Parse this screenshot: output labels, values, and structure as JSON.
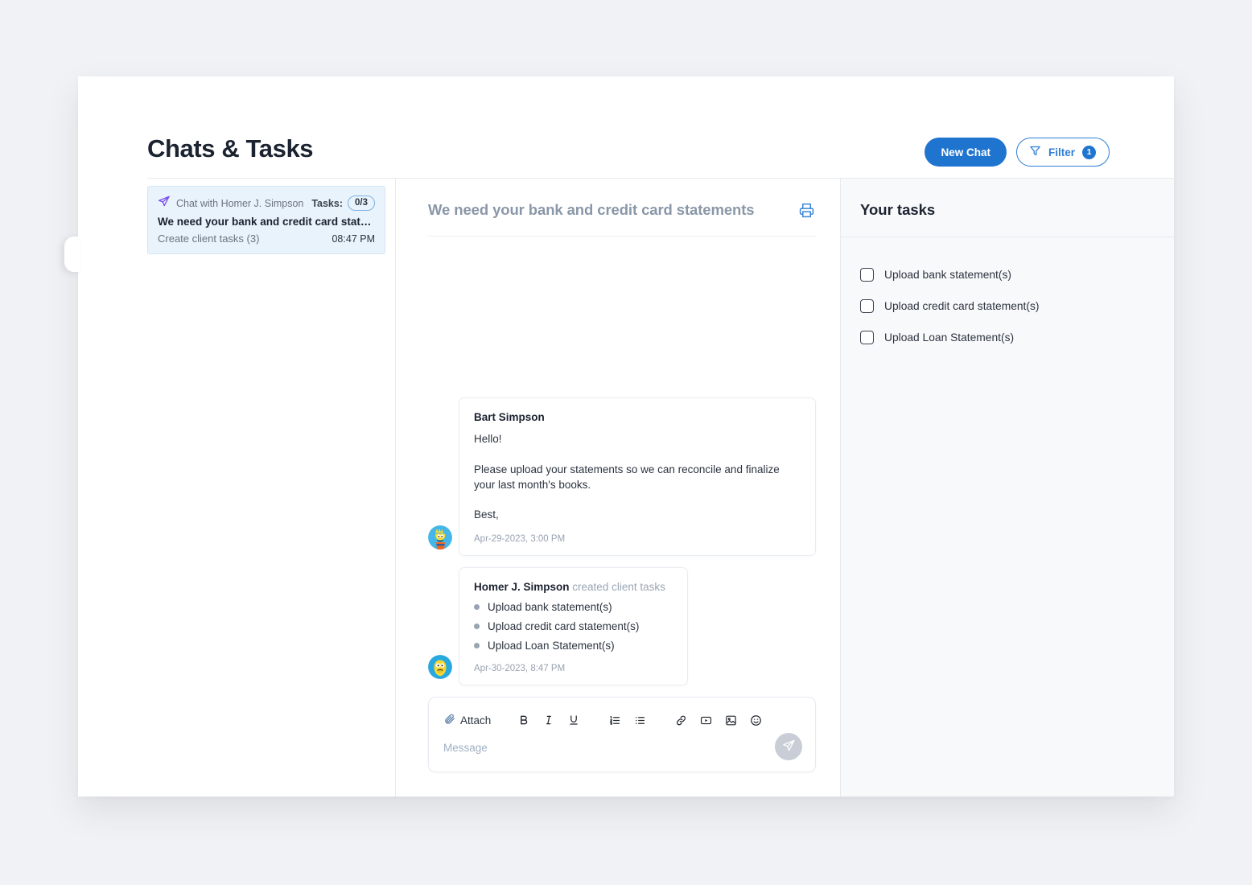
{
  "header": {
    "title": "Chats & Tasks",
    "new_chat_label": "New Chat",
    "filter_label": "Filter",
    "filter_badge": "1"
  },
  "chat_list": {
    "items": [
      {
        "chat_with": "Chat with Homer J. Simpson",
        "tasks_label": "Tasks:",
        "tasks_count": "0/3",
        "subject": "We need your bank and credit card stateme…",
        "preview": "Create client tasks (3)",
        "time": "08:47 PM"
      }
    ]
  },
  "thread": {
    "title": "We need your bank and credit card statements",
    "messages": [
      {
        "author": "Bart Simpson",
        "action": "",
        "line1": "Hello!",
        "line2": "Please upload your statements so we can reconcile and finalize your last month's books.",
        "line3": "Best,",
        "time": "Apr-29-2023, 3:00 PM"
      },
      {
        "author": "Homer J. Simpson",
        "action": "created client tasks",
        "tasks": [
          "Upload bank statement(s)",
          "Upload credit card statement(s)",
          "Upload Loan Statement(s)"
        ],
        "time": "Apr-30-2023, 8:47 PM"
      }
    ]
  },
  "composer": {
    "attach_label": "Attach",
    "placeholder": "Message",
    "tools": [
      "bold",
      "italic",
      "underline",
      "ordered-list",
      "bullet-list",
      "link",
      "video",
      "image",
      "emoji"
    ]
  },
  "tasks_panel": {
    "title": "Your tasks",
    "items": [
      {
        "label": "Upload bank statement(s)",
        "checked": false
      },
      {
        "label": "Upload credit card statement(s)",
        "checked": false
      },
      {
        "label": "Upload Loan Statement(s)",
        "checked": false
      }
    ]
  },
  "colors": {
    "accent_blue": "#1f74d0",
    "plane_purple": "#7b4ff0",
    "page_bg": "#f1f2f5",
    "panel_bg": "#f8f9fb"
  }
}
